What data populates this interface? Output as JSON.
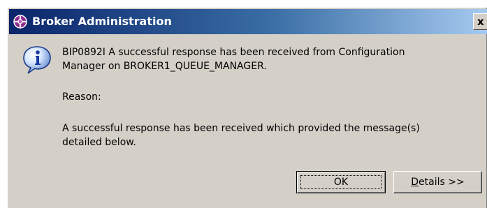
{
  "window": {
    "title": "Broker Administration",
    "close_label": "x"
  },
  "message": {
    "icon": "info-icon",
    "line1": "BIP0892I A successful response has been received from Configuration",
    "line2": "Manager on BROKER1_QUEUE_MANAGER.",
    "reason_label": "Reason:",
    "reason_line1": "A successful response has been received which provided the message(s)",
    "reason_line2": "detailed below."
  },
  "buttons": {
    "ok_label": "OK",
    "details_mnemonic": "D",
    "details_rest": "etails >>"
  },
  "colors": {
    "titlebar_start": "#0a246a",
    "titlebar_end": "#a6caf0",
    "dialog_face": "#d4d0c8"
  }
}
